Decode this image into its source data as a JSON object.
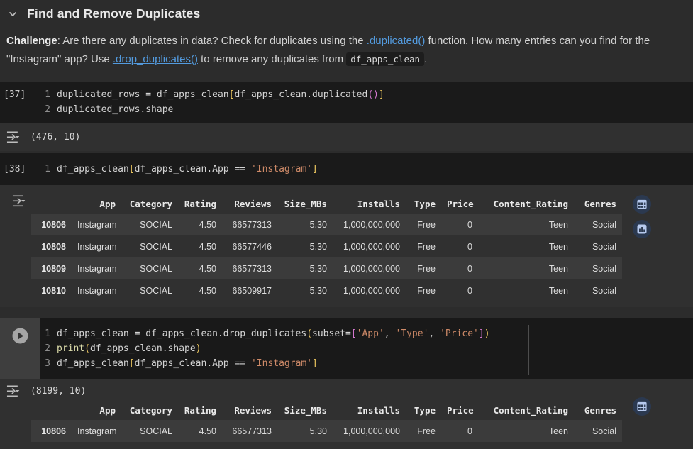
{
  "section": {
    "title": "Find and Remove Duplicates"
  },
  "challenge": {
    "parts": [
      [
        "b",
        "Challenge"
      ],
      [
        "t",
        ": Are there any duplicates in data? Check for duplicates using the "
      ],
      [
        "a",
        ".duplicated()",
        "duplicated-link"
      ],
      [
        "t",
        " function. How many entries can you find for the \"Instagram\" app? Use "
      ],
      [
        "a",
        ".drop_duplicates()",
        "drop-duplicates-link"
      ],
      [
        "t",
        " to remove any duplicates from "
      ],
      [
        "c",
        "df_apps_clean"
      ],
      [
        "t",
        "."
      ]
    ]
  },
  "cells": {
    "c37": {
      "label": "[37]",
      "lines": [
        [
          [
            "p",
            "duplicated_rows = df_apps_clean"
          ],
          [
            "b1",
            "["
          ],
          [
            "p",
            "df_apps_clean.duplicated"
          ],
          [
            "b2",
            "()"
          ],
          [
            "b1",
            "]"
          ]
        ],
        [
          [
            "p",
            "duplicated_rows.shape"
          ]
        ]
      ]
    },
    "c38": {
      "label": "[38]",
      "lines": [
        [
          [
            "p",
            "df_apps_clean"
          ],
          [
            "b1",
            "["
          ],
          [
            "p",
            "df_apps_clean.App == "
          ],
          [
            "s",
            "'Instagram'"
          ],
          [
            "b1",
            "]"
          ]
        ]
      ]
    },
    "run": {
      "lines": [
        [
          [
            "p",
            "df_apps_clean = df_apps_clean.drop_duplicates"
          ],
          [
            "b1",
            "("
          ],
          [
            "p",
            "subset="
          ],
          [
            "b2",
            "["
          ],
          [
            "s",
            "'App'"
          ],
          [
            "p",
            ", "
          ],
          [
            "s",
            "'Type'"
          ],
          [
            "p",
            ", "
          ],
          [
            "s",
            "'Price'"
          ],
          [
            "b2",
            "]"
          ],
          [
            "b1",
            ")"
          ]
        ],
        [
          [
            "f",
            "print"
          ],
          [
            "b1",
            "("
          ],
          [
            "p",
            "df_apps_clean.shape"
          ],
          [
            "b1",
            ")"
          ]
        ],
        [
          [
            "p",
            "df_apps_clean"
          ],
          [
            "b1",
            "["
          ],
          [
            "p",
            "df_apps_clean.App == "
          ],
          [
            "s",
            "'Instagram'"
          ],
          [
            "b1",
            "]"
          ]
        ]
      ]
    }
  },
  "outputs": {
    "shape1": "(476, 10)",
    "shape2": "(8199, 10)"
  },
  "table": {
    "columns": [
      "",
      "App",
      "Category",
      "Rating",
      "Reviews",
      "Size_MBs",
      "Installs",
      "Type",
      "Price",
      "Content_Rating",
      "Genres"
    ],
    "rows1": [
      [
        "10806",
        "Instagram",
        "SOCIAL",
        "4.50",
        "66577313",
        "5.30",
        "1,000,000,000",
        "Free",
        "0",
        "Teen",
        "Social"
      ],
      [
        "10808",
        "Instagram",
        "SOCIAL",
        "4.50",
        "66577446",
        "5.30",
        "1,000,000,000",
        "Free",
        "0",
        "Teen",
        "Social"
      ],
      [
        "10809",
        "Instagram",
        "SOCIAL",
        "4.50",
        "66577313",
        "5.30",
        "1,000,000,000",
        "Free",
        "0",
        "Teen",
        "Social"
      ],
      [
        "10810",
        "Instagram",
        "SOCIAL",
        "4.50",
        "66509917",
        "5.30",
        "1,000,000,000",
        "Free",
        "0",
        "Teen",
        "Social"
      ]
    ],
    "rows2": [
      [
        "10806",
        "Instagram",
        "SOCIAL",
        "4.50",
        "66577313",
        "5.30",
        "1,000,000,000",
        "Free",
        "0",
        "Teen",
        "Social"
      ]
    ]
  },
  "icons": {
    "collapse": "chevron-down",
    "output": "output-arrow",
    "table_view": "table-grid",
    "chart_view": "bar-chart",
    "run": "play-circle"
  },
  "colors": {
    "page_bg": "#2c2c2c",
    "code_bg": "#1a1a1a",
    "output_bg": "#303030",
    "row_stripe": "#3b3b3b",
    "link_blue": "#539bdf",
    "bracket_gold": "#eac55e",
    "bracket_pink": "#d478cf",
    "string_orange": "#ce8a68",
    "icon_blue": "#b6c9ee",
    "icon_circle_bg": "#2b3950"
  }
}
